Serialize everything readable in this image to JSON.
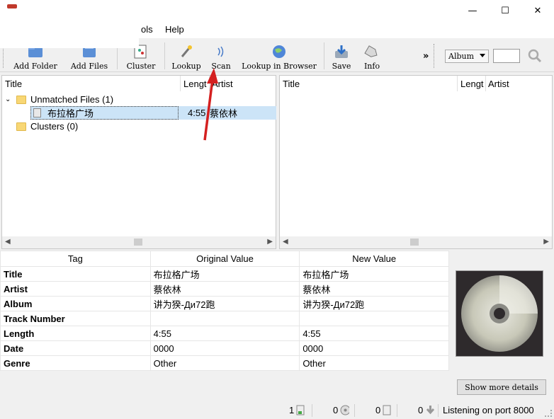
{
  "window": {
    "minimize_label": "—",
    "maximize_label": "☐",
    "close_label": "✕"
  },
  "menu": {
    "tools_partial": "ols",
    "help": "Help"
  },
  "toolbar": {
    "add_folder": "Add Folder",
    "add_files": "Add Files",
    "cluster": "Cluster",
    "lookup": "Lookup",
    "scan": "Scan",
    "lookup_browser": "Lookup in Browser",
    "save": "Save",
    "info": "Info",
    "overflow": "»",
    "search_type": "Album",
    "search_value": ""
  },
  "left_pane": {
    "headers": [
      "Title",
      "Lengt",
      "Artist"
    ],
    "unmatched_label": "Unmatched Files (1)",
    "file": {
      "title": "布拉格广场",
      "length": "4:55",
      "artist": "蔡依林"
    },
    "clusters_label": "Clusters (0)"
  },
  "right_pane": {
    "headers": [
      "Title",
      "Lengt",
      "Artist"
    ]
  },
  "tag_table": {
    "headers": [
      "Tag",
      "Original Value",
      "New Value"
    ],
    "rows": [
      {
        "tag": "Title",
        "original": "布拉格广场",
        "new": "布拉格广场"
      },
      {
        "tag": "Artist",
        "original": "蔡依林",
        "new": "蔡依林"
      },
      {
        "tag": "Album",
        "original": "讲为猤-Ди72跑",
        "new": "讲为猤-Ди72跑"
      },
      {
        "tag": "Track Number",
        "original": "",
        "new": ""
      },
      {
        "tag": "Length",
        "original": "4:55",
        "new": "4:55"
      },
      {
        "tag": "Date",
        "original": "0000",
        "new": "0000"
      },
      {
        "tag": "Genre",
        "original": "Other",
        "new": "Other"
      }
    ]
  },
  "cover": {
    "button": "Show more details"
  },
  "status": {
    "files": "1",
    "albums": "0",
    "pending": "0",
    "requests": "0",
    "listening": "Listening on port 8000"
  }
}
